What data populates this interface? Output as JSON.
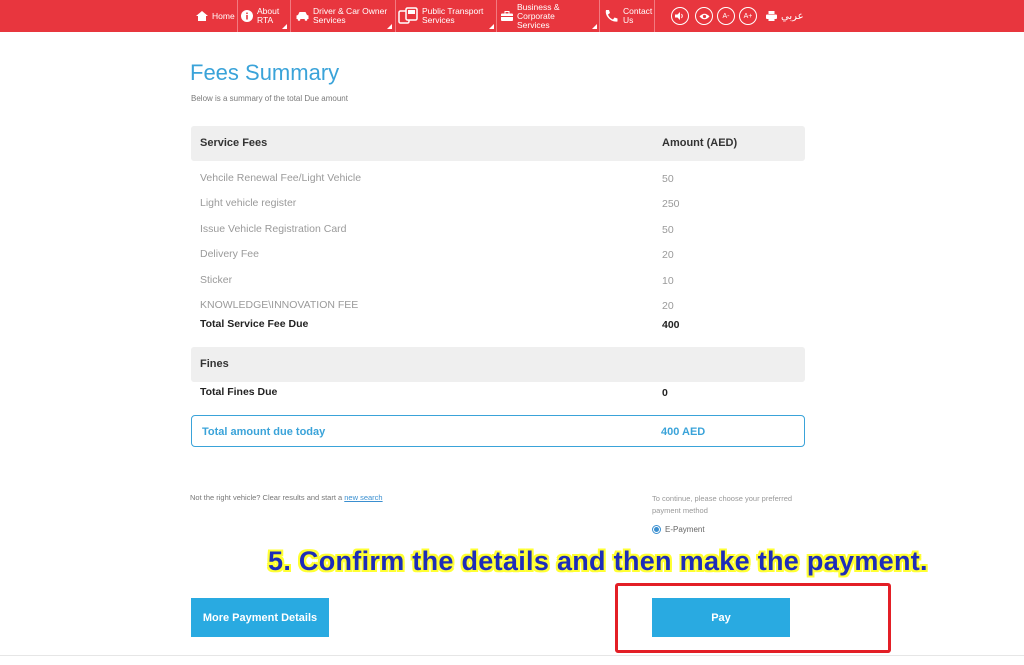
{
  "nav": {
    "home": "Home",
    "about_1": "About",
    "about_2": "RTA",
    "driver_1": "Driver & Car Owner",
    "driver_2": "Services",
    "public_1": "Public Transport",
    "public_2": "Services",
    "business_1": "Business & Corporate",
    "business_2": "Services",
    "contact_1": "Contact",
    "contact_2": "Us",
    "a_minus": "A-",
    "a_plus": "A+",
    "arabic": "عربي"
  },
  "page": {
    "title": "Fees Summary",
    "subtitle": "Below is a summary of the total Due amount"
  },
  "service_fees": {
    "header_label": "Service Fees",
    "header_amount": "Amount (AED)",
    "items": [
      {
        "label": "Vehcile Renewal Fee/Light Vehicle",
        "amount": "50"
      },
      {
        "label": "Light vehicle register",
        "amount": "250"
      },
      {
        "label": "Issue Vehicle Registration Card",
        "amount": "50"
      },
      {
        "label": "Delivery Fee",
        "amount": "20"
      },
      {
        "label": "Sticker",
        "amount": "10"
      },
      {
        "label": "KNOWLEDGE\\INNOVATION FEE",
        "amount": "20"
      }
    ],
    "total_label": "Total Service Fee Due",
    "total_amount": "400"
  },
  "fines": {
    "header_label": "Fines",
    "total_label": "Total Fines Due",
    "total_amount": "0"
  },
  "total": {
    "label": "Total amount due today",
    "amount": "400 AED"
  },
  "footer": {
    "note": "Not the right vehicle? Clear results and start a ",
    "new_search": "new search",
    "payment_note": "To continue, please choose your preferred payment method",
    "payment_option": "E-Payment"
  },
  "buttons": {
    "more_details": "More Payment Details",
    "pay": "Pay"
  },
  "annotation": "5. Confirm the details and then make the payment.",
  "colors": {
    "header_red": "#e8363e",
    "accent_blue": "#3aa3d9",
    "button_blue": "#29aae1",
    "highlight_red": "#e31f26",
    "annotation_text": "#1e2db8",
    "annotation_outline": "#ffff33"
  }
}
